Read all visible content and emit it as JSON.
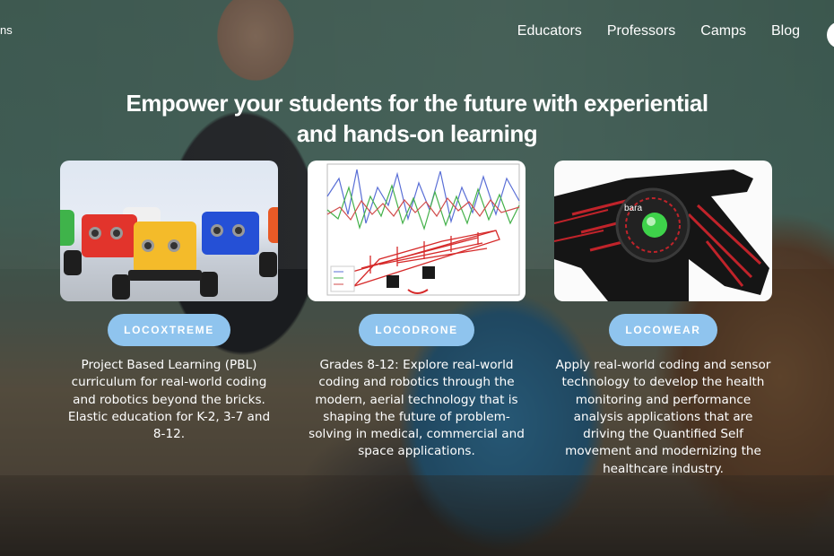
{
  "nav": {
    "brand_fragment": "ns",
    "items": [
      "Educators",
      "Professors",
      "Camps",
      "Blog"
    ]
  },
  "headline": {
    "line1": "Empower your students for the future with experiential",
    "line2": "and hands-on learning"
  },
  "cards": [
    {
      "button": "LOCOXTREME",
      "description": "Project Based Learning (PBL) curriculum for real-world coding and robotics beyond the bricks. Elastic education for K-2, 3-7 and 8-12."
    },
    {
      "button": "LOCODRONE",
      "description": "Grades 8-12: Explore real-world coding and robotics through the modern, aerial technology that is shaping the future of problem-solving in medical, commercial and space applications."
    },
    {
      "button": "LOCOWEAR",
      "description": "Apply real-world coding and sensor technology to develop the health monitoring and performance analysis applications that are driving the Quantified Self movement and modernizing the healthcare industry."
    }
  ],
  "colors": {
    "pill": "#8fc4ee",
    "text": "#ffffff"
  }
}
